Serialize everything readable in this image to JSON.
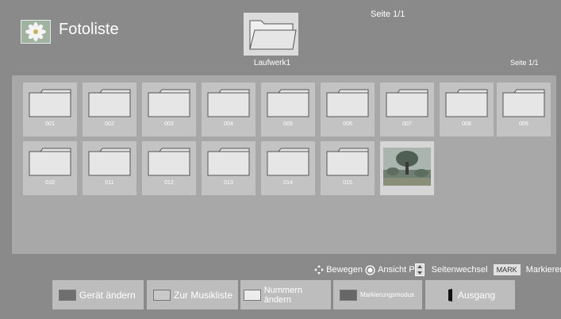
{
  "header": {
    "title": "Fotoliste",
    "page_indicator_top": "Seite 1/1",
    "drive_label": "Laufwerk1",
    "page_indicator_right": "Seite 1/1"
  },
  "grid": {
    "folders": [
      "001",
      "002",
      "003",
      "004",
      "005",
      "006",
      "007",
      "008",
      "009",
      "010",
      "011",
      "012",
      "013",
      "014",
      "015"
    ],
    "photo_icon": "photo-thumbnail"
  },
  "legend": {
    "move": "Bewegen",
    "view": "Ansicht",
    "page_key": "P",
    "page_change": "Seitenwechsel",
    "mark_key": "MARK",
    "mark": "Markieren"
  },
  "buttons": {
    "device": "Gerät ändern",
    "music": "Zur Musikliste",
    "number": "Nummern ändern",
    "mark_mode": "Markierungsmodus",
    "exit": "Ausgang"
  },
  "colors": {
    "background": "#8a8a8a",
    "panel": "#a8a8a8",
    "tile": "#c3c3c3"
  }
}
